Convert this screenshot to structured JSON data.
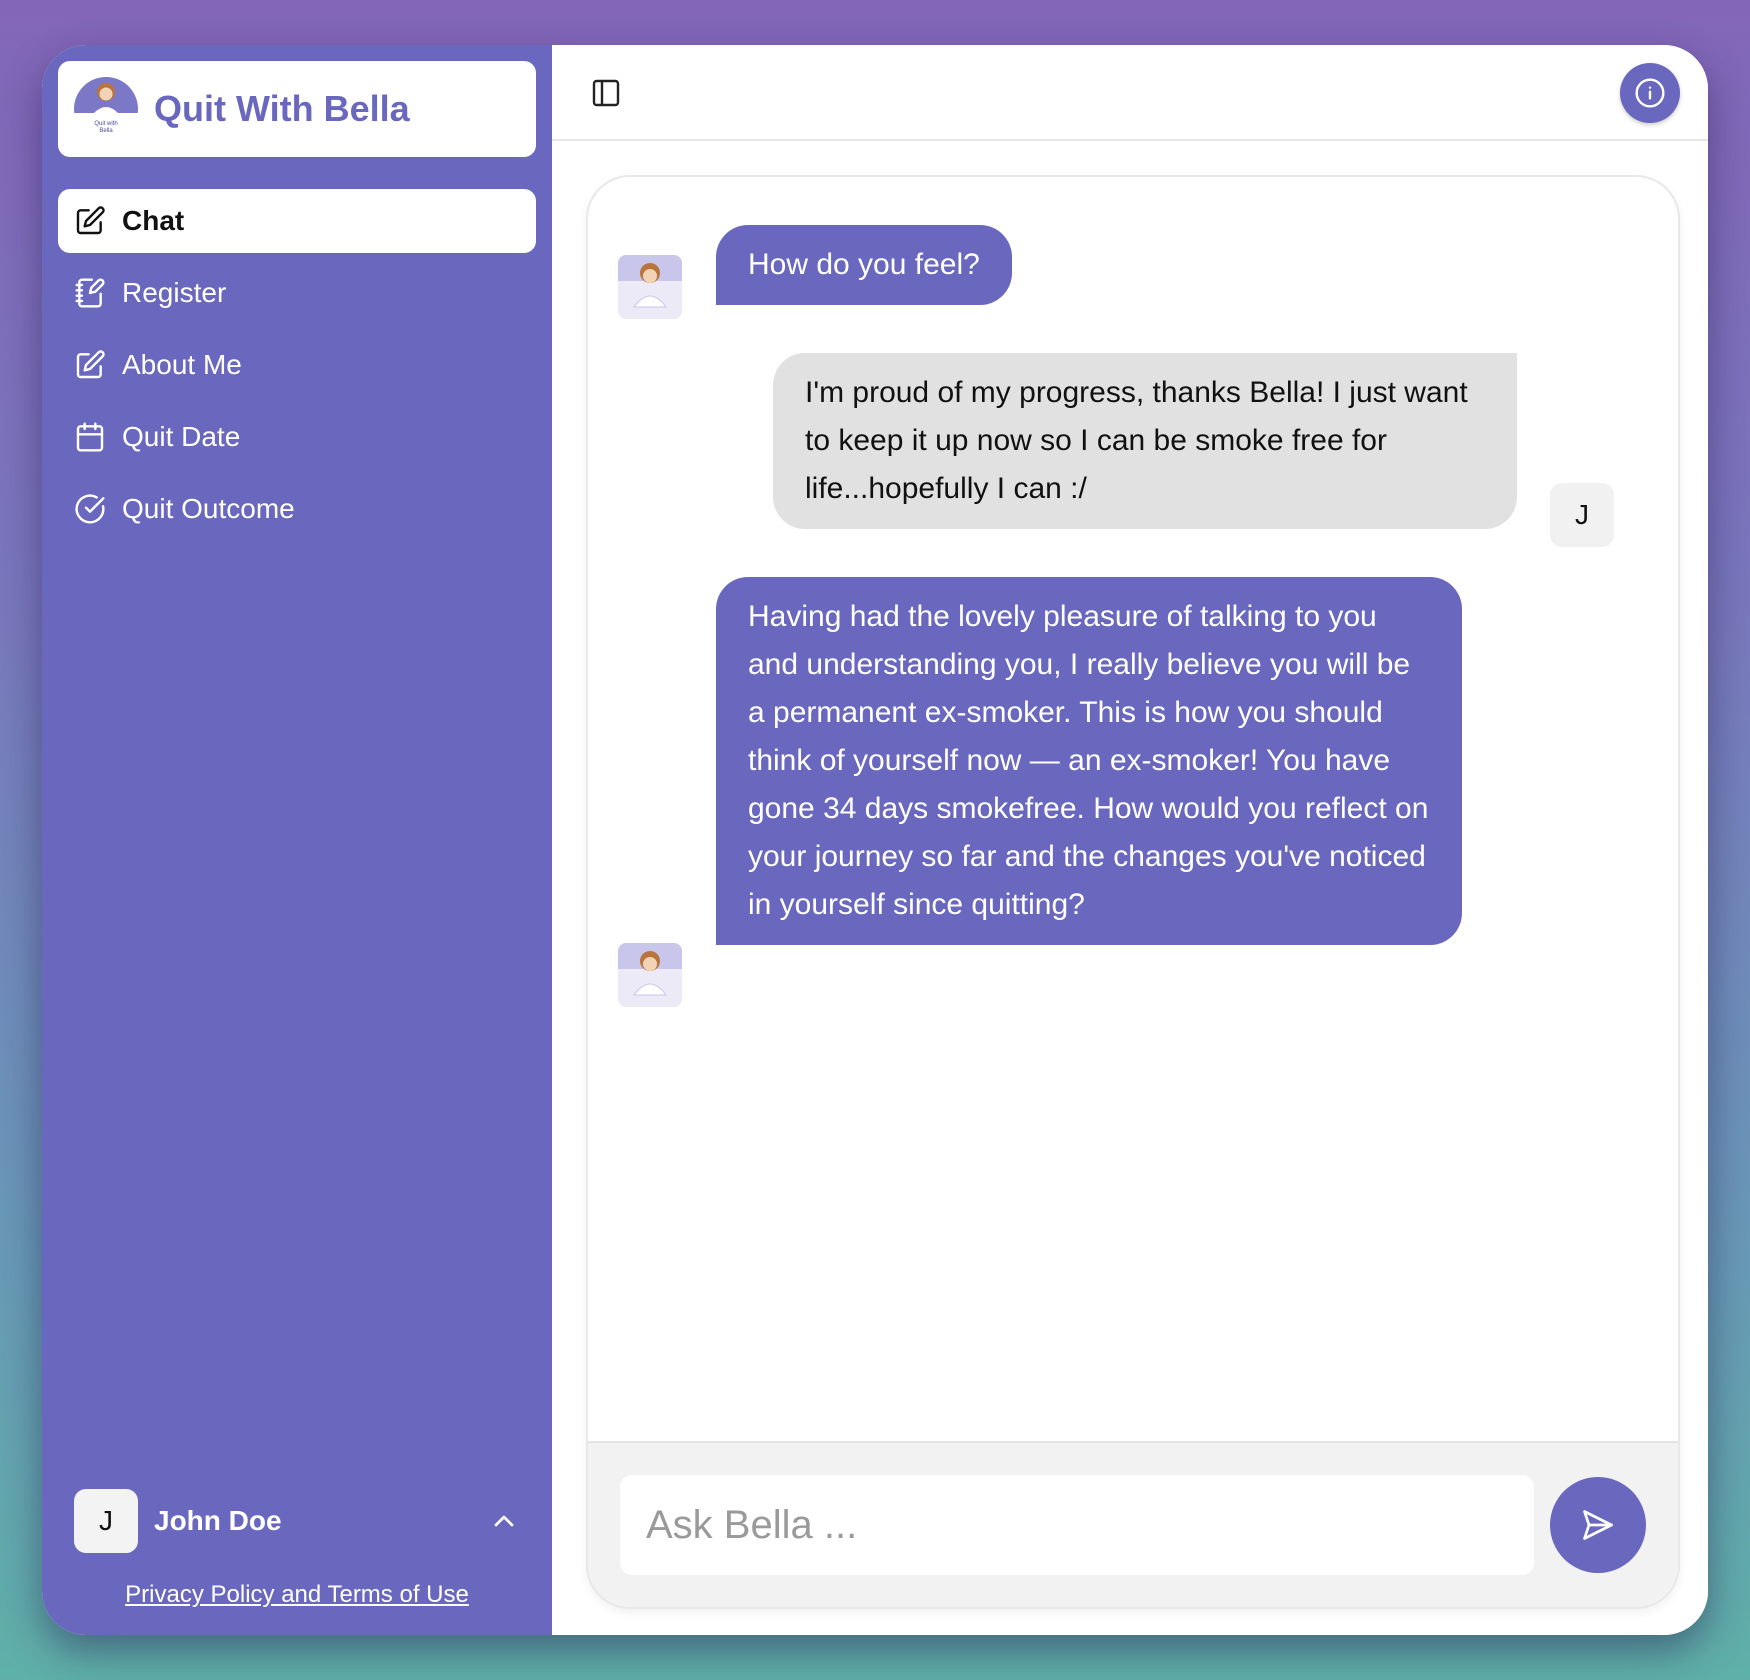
{
  "brand": {
    "title": "Quit With Bella",
    "logo_text": "Quit with Bella"
  },
  "nav": [
    {
      "label": "Chat",
      "icon": "pencil-square-icon",
      "active": true
    },
    {
      "label": "Register",
      "icon": "notebook-edit-icon"
    },
    {
      "label": "About Me",
      "icon": "pencil-square-icon"
    },
    {
      "label": "Quit Date",
      "icon": "calendar-icon"
    },
    {
      "label": "Quit Outcome",
      "icon": "check-circle-icon"
    }
  ],
  "user": {
    "initial": "J",
    "name": "John Doe"
  },
  "footer": {
    "privacy_link": "Privacy Policy and Terms of Use"
  },
  "chat": {
    "messages": [
      {
        "sender": "bot",
        "text": "How do you feel?"
      },
      {
        "sender": "user",
        "initial": "J",
        "text": "I'm proud of my progress, thanks Bella! I just want to keep it up now so I can be smoke free for life...hopefully I can :/"
      },
      {
        "sender": "bot",
        "text": "Having had the lovely pleasure of talking to you and understanding you, I really believe you will be a permanent ex-smoker. This is how you should think of yourself now — an ex-smoker! You have gone 34 days smokefree. How would you reflect on your journey so far and the changes you've noticed in yourself since quitting?"
      }
    ],
    "input_placeholder": "Ask Bella ...",
    "input_value": ""
  },
  "colors": {
    "accent": "#6a68be",
    "user_bubble": "#e1e1e1",
    "background_top": "#8366b8",
    "background_bottom": "#5fb0a8"
  }
}
